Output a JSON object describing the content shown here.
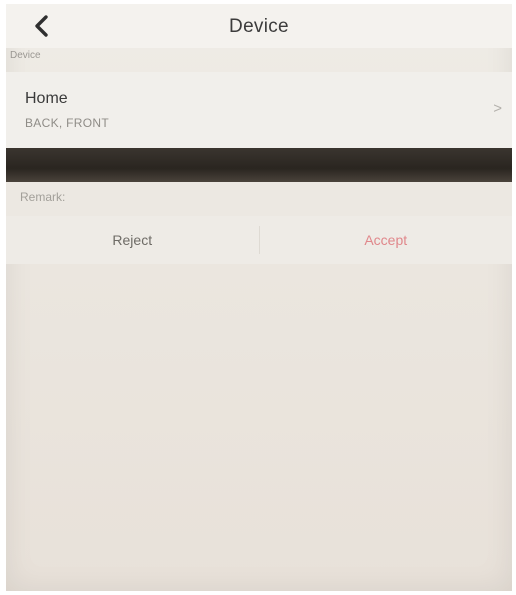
{
  "header": {
    "title": "Device",
    "back_icon": "chevron-left-icon"
  },
  "section": {
    "label": "Device"
  },
  "device": {
    "name": "Home",
    "sub": "BACK, FRONT",
    "chevron": ">"
  },
  "remark": {
    "label": "Remark:"
  },
  "actions": {
    "reject_label": "Reject",
    "accept_label": "Accept",
    "accept_color": "#e0878b"
  }
}
